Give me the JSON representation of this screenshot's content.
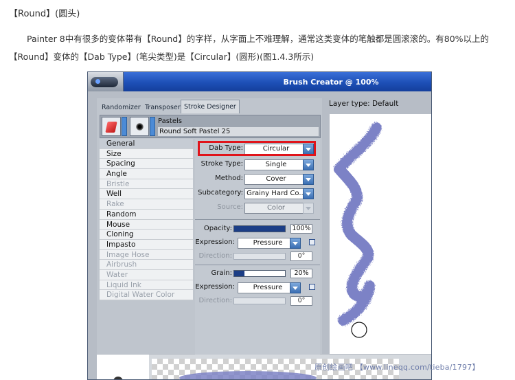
{
  "article": {
    "title": "【Round】(圆头)",
    "paragraph": "Painter 8中有很多的变体带有【Round】的字样，从字面上不难理解，通常这类变体的笔触都是圆滚滚的。有80%以上的【Round】变体的【Dab Type】(笔尖类型)是【Circular】(圆形)(图1.4.3所示)"
  },
  "window": {
    "title": "Brush Creator @ 100%",
    "tabs": [
      "Randomizer",
      "Transposer",
      "Stroke Designer"
    ],
    "brush": {
      "category": "Pastels",
      "variant": "Round Soft Pastel 25"
    },
    "sections": [
      {
        "label": "General",
        "state": "selected"
      },
      {
        "label": "Size",
        "state": "normal"
      },
      {
        "label": "Spacing",
        "state": "normal"
      },
      {
        "label": "Angle",
        "state": "normal"
      },
      {
        "label": "Bristle",
        "state": "disabled"
      },
      {
        "label": "Well",
        "state": "normal"
      },
      {
        "label": "Rake",
        "state": "disabled"
      },
      {
        "label": "Random",
        "state": "normal"
      },
      {
        "label": "Mouse",
        "state": "normal"
      },
      {
        "label": "Cloning",
        "state": "normal"
      },
      {
        "label": "Impasto",
        "state": "normal"
      },
      {
        "label": "Image Hose",
        "state": "disabled"
      },
      {
        "label": "Airbrush",
        "state": "disabled"
      },
      {
        "label": "Water",
        "state": "disabled"
      },
      {
        "label": "Liquid Ink",
        "state": "disabled"
      },
      {
        "label": "Digital Water Color",
        "state": "disabled"
      }
    ],
    "general": {
      "dab_type": {
        "label": "Dab Type:",
        "value": "Circular"
      },
      "stroke_type": {
        "label": "Stroke Type:",
        "value": "Single"
      },
      "method": {
        "label": "Method:",
        "value": "Cover"
      },
      "subcategory": {
        "label": "Subcategory:",
        "value": "Grainy Hard Co..."
      },
      "source": {
        "label": "Source:",
        "value": "Color"
      },
      "opacity": {
        "label": "Opacity:",
        "value": "100%",
        "level": 1.0
      },
      "opacity_expression": {
        "label": "Expression:",
        "value": "Pressure"
      },
      "opacity_direction": {
        "label": "Direction:",
        "value": "0°"
      },
      "grain": {
        "label": "Grain:",
        "value": "20%",
        "level": 0.2
      },
      "grain_expression": {
        "label": "Expression:",
        "value": "Pressure"
      },
      "grain_direction": {
        "label": "Direction:",
        "value": "0°"
      }
    },
    "preview": {
      "layer_type": "Layer type: Default"
    }
  },
  "watermark": "原创绘画吧 【www.lineqq.com/tieba/1797】",
  "colors": {
    "highlight": "#e0141b",
    "titlebar": "#1d4fb6",
    "stroke_preview": "#6e74c0"
  }
}
